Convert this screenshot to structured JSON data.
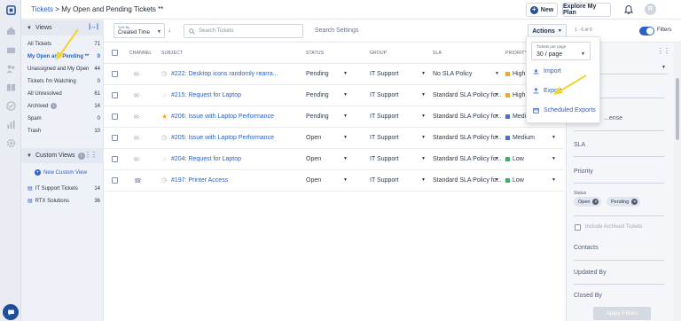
{
  "app": {
    "breadcrumb_root": "Tickets",
    "breadcrumb_sep": ">",
    "breadcrumb_current": "My Open and Pending Tickets **",
    "new_button": "New",
    "explore_button": "Explore My Plan",
    "avatar_initial": "R"
  },
  "views": {
    "header": "Views",
    "items": [
      {
        "label": "All Tickets",
        "count": "71"
      },
      {
        "label": "My Open and Pending **",
        "count": "0"
      },
      {
        "label": "Unassigned and My Open",
        "count": "44"
      },
      {
        "label": "Tickets I'm Watching",
        "count": "0"
      },
      {
        "label": "All Unresolved",
        "count": "61"
      },
      {
        "label": "Archived",
        "count": "14"
      },
      {
        "label": "Spam",
        "count": "0"
      },
      {
        "label": "Trash",
        "count": "10"
      }
    ],
    "custom_header": "Custom Views",
    "new_custom_view": "New Custom View",
    "custom_items": [
      {
        "label": "IT Support Tickets",
        "count": "14"
      },
      {
        "label": "RTX Solutions",
        "count": "36"
      }
    ]
  },
  "toolbar": {
    "sort_caption": "Sort By",
    "sort_value": "Created Time",
    "search_placeholder": "Search Tickets",
    "search_settings": "Search Settings",
    "actions_label": "Actions",
    "pager": "1 - 6 of 6",
    "filters_label": "Filters"
  },
  "table": {
    "headers": {
      "channel": "CHANNEL",
      "subject": "SUBJECT",
      "status": "STATUS",
      "group": "GROUP",
      "sla": "SLA",
      "priority": "PRIORITY"
    },
    "rows": [
      {
        "subject": "#222: Desktop icons randomly rearra...",
        "status": "Pending",
        "group": "IT Support",
        "sla": "No SLA Policy",
        "priority": "High"
      },
      {
        "subject": "#215: Request for Laptop",
        "status": "Pending",
        "group": "IT Support",
        "sla": "Standard SLA Policy fo...",
        "priority": "High"
      },
      {
        "subject": "#206: Issue with Laptop Performance",
        "status": "Pending",
        "group": "IT Support",
        "sla": "Standard SLA Policy fo...",
        "priority": "Medium"
      },
      {
        "subject": "#205: Issue with Laptop Performance",
        "status": "Open",
        "group": "IT Support",
        "sla": "Standard SLA Policy fo...",
        "priority": "Medium"
      },
      {
        "subject": "#204: Request for Laptop",
        "status": "Open",
        "group": "IT Support",
        "sla": "Standard SLA Policy fo...",
        "priority": "Low"
      },
      {
        "subject": "#197: Printer Access",
        "status": "Open",
        "group": "IT Support",
        "sla": "Standard SLA Policy fo...",
        "priority": "Low"
      }
    ]
  },
  "actions_menu": {
    "tpp_caption": "Tickets per page",
    "tpp_value": "30 / page",
    "import": "Import",
    "export": "Export",
    "scheduled": "Scheduled Exports"
  },
  "filters": {
    "partial_label": "...ense",
    "sla": "SLA",
    "priority": "Priority",
    "status": "Status",
    "chip_open": "Open",
    "chip_pending": "Pending",
    "include_archived": "Include Archived Tickets",
    "contacts": "Contacts",
    "updated_by": "Updated By",
    "closed_by": "Closed By",
    "apply": "Apply Filters"
  },
  "colors": {
    "accent": "#2a61c9",
    "high": "#f5a623",
    "medium": "#4a6fd0",
    "low": "#3fae5a",
    "annotation": "#f2d531"
  }
}
